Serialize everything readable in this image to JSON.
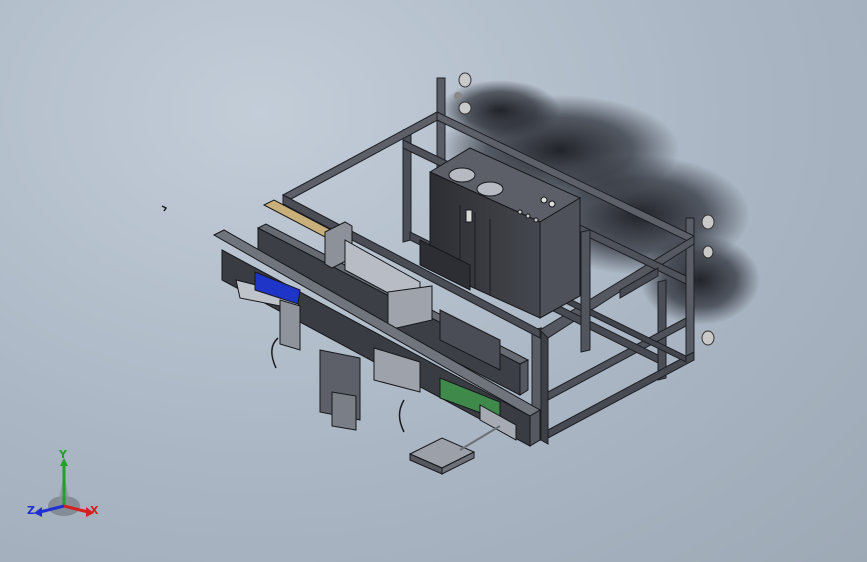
{
  "viewport": {
    "background_top": "#c3cdd8",
    "background_bottom": "#9ea9b6"
  },
  "model": {
    "frame_color": "#4a4d55",
    "panel_color": "#3b3d44",
    "accent_blue": "#1f35c8",
    "accent_green": "#3f8a4a",
    "wood_color": "#c9b07a"
  },
  "triad": {
    "x_label": "X",
    "y_label": "Y",
    "z_label": "Z",
    "x_color": "#d42020",
    "y_color": "#22a02a",
    "z_color": "#2030d0"
  }
}
